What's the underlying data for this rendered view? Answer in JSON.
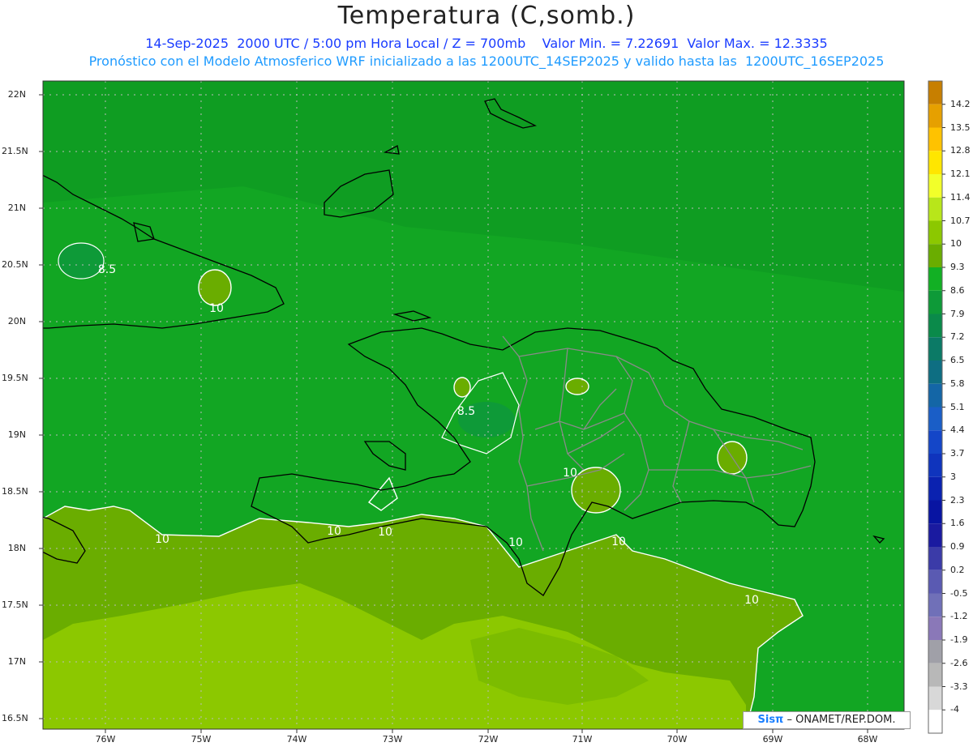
{
  "header": {
    "title": "Temperatura (C,somb.)",
    "subtitle_line1": "14-Sep-2025  2000 UTC / 5:00 pm Hora Local / Z = 700mb    Valor Min. = 7.22691  Valor Max. = 12.3335",
    "subtitle_line2": "Pronóstico con el Modelo Atmosferico WRF inicializado a las 1200UTC_14SEP2025 y valido hasta las  1200UTC_16SEP2025"
  },
  "axes": {
    "lat_labels": [
      "22N",
      "21.5N",
      "21N",
      "20.5N",
      "20N",
      "19.5N",
      "19N",
      "18.5N",
      "18N",
      "17.5N",
      "17N",
      "16.5N"
    ],
    "lon_labels": [
      "76W",
      "75W",
      "74W",
      "73W",
      "72W",
      "71W",
      "70W",
      "69W",
      "68W"
    ]
  },
  "contour_labels": [
    "8.5",
    "10",
    "8.5",
    "10",
    "10",
    "10",
    "10",
    "10",
    "10",
    "10"
  ],
  "colorbar": {
    "labels": [
      "14.2",
      "13.5",
      "12.8",
      "12.1",
      "11.4",
      "10.7",
      "10",
      "9.3",
      "8.6",
      "7.9",
      "7.2",
      "6.5",
      "5.8",
      "5.1",
      "4.4",
      "3.7",
      "3",
      "2.3",
      "1.6",
      "0.9",
      "0.2",
      "-0.5",
      "-1.2",
      "-1.9",
      "-2.6",
      "-3.3",
      "-4"
    ],
    "colors": [
      "#c77f00",
      "#e6a000",
      "#ffc200",
      "#ffe600",
      "#f2ff2a",
      "#b8e61a",
      "#8cc800",
      "#6aad00",
      "#12b024",
      "#0e9a38",
      "#0a8a4a",
      "#0b7a66",
      "#0e6e82",
      "#1466a6",
      "#1a5ec7",
      "#1446c8",
      "#0f34bd",
      "#0a22b0",
      "#0814a2",
      "#1a1aa0",
      "#3b3ba8",
      "#5a5ab2",
      "#7070b8",
      "#8a78b8",
      "#a0a0a8",
      "#b8b8b8",
      "#d8d8d8",
      "#ffffff"
    ]
  },
  "credit": {
    "logo": "Sisπ",
    "text": " – ONAMET/REP.DOM."
  }
}
